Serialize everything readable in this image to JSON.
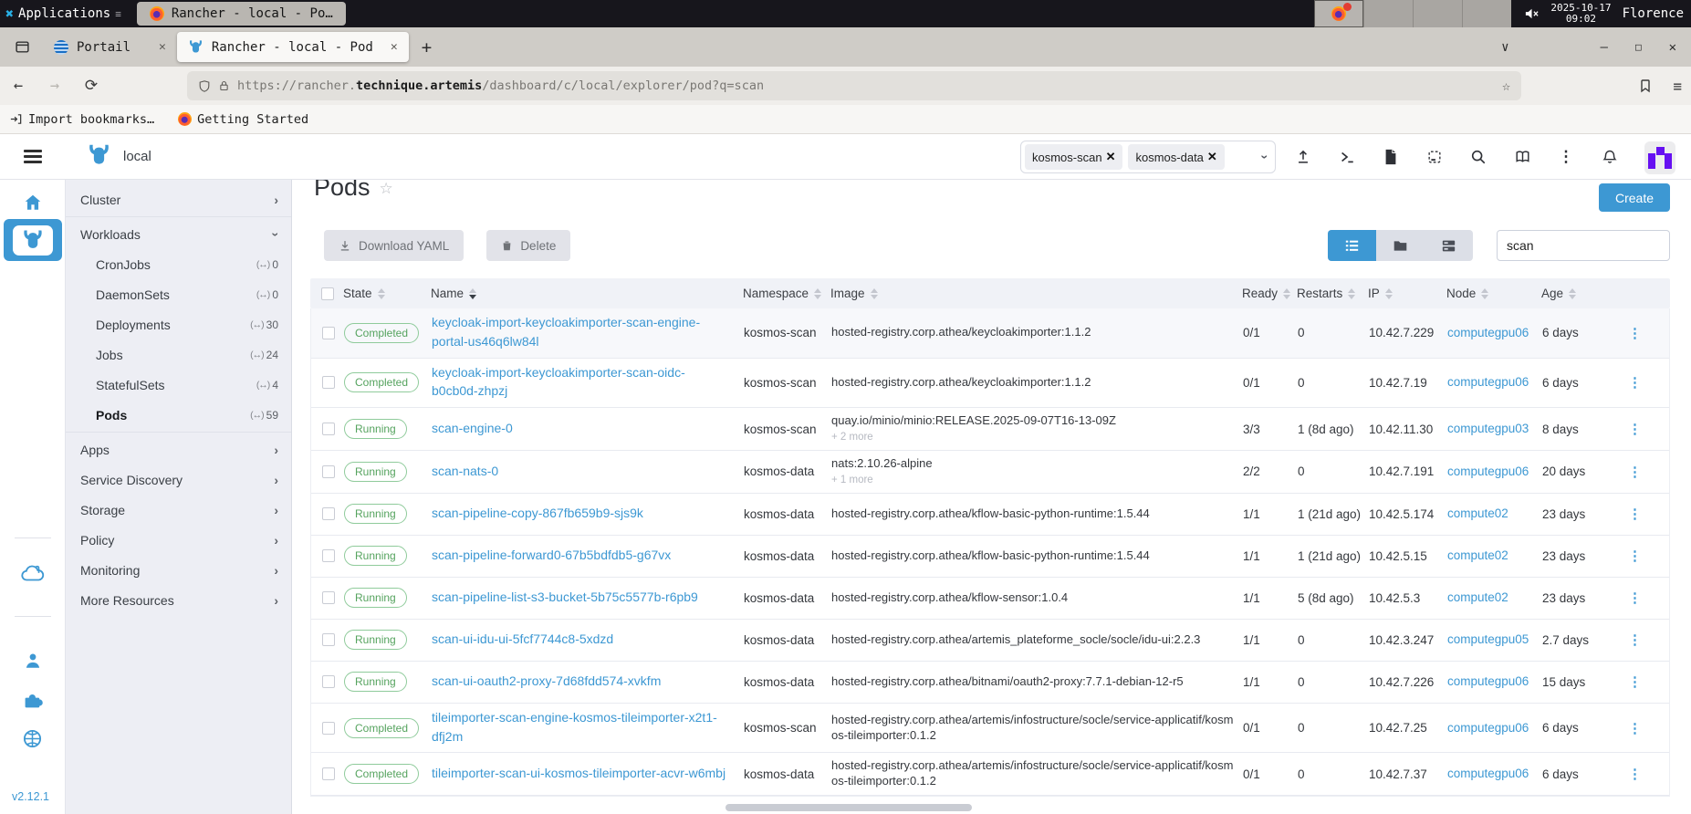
{
  "system_bar": {
    "applications_label": "Applications",
    "window_title": "Rancher - local - Po…",
    "date": "2025-10-17",
    "time": "09:02",
    "user": "Florence"
  },
  "browser": {
    "tab1_label": "Portail",
    "tab2_label": "Rancher - local - Pod",
    "close_glyph": "✕",
    "new_tab_glyph": "+",
    "back_glyph": "←",
    "forward_glyph": "→",
    "reload_glyph": "⟳",
    "url_prefix": "https://rancher.",
    "url_domain": "technique.artemis",
    "url_path": "/dashboard/c/local/explorer/pod?q=scan",
    "star_glyph": "☆",
    "bookmark1": "Import bookmarks…",
    "bookmark2": "Getting Started",
    "tab_chevron": "∨",
    "minimize_glyph": "–",
    "maximize_glyph": "□",
    "menu_glyph": "≡"
  },
  "header": {
    "cluster_name": "local",
    "namespace_chips": [
      "kosmos-scan",
      "kosmos-data"
    ],
    "icons": [
      "upload-icon",
      "terminal-icon",
      "file-icon",
      "clipboard-icon",
      "search-icon",
      "book-icon",
      "kebab-menu-icon",
      "bell-icon"
    ]
  },
  "sidebar": {
    "items": [
      {
        "label": "Cluster",
        "chevron": "right",
        "sep_after": true
      },
      {
        "label": "Workloads",
        "chevron": "down"
      },
      {
        "label": "CronJobs",
        "count": "0",
        "sub": true
      },
      {
        "label": "DaemonSets",
        "count": "0",
        "sub": true
      },
      {
        "label": "Deployments",
        "count": "30",
        "sub": true
      },
      {
        "label": "Jobs",
        "count": "24",
        "sub": true
      },
      {
        "label": "StatefulSets",
        "count": "4",
        "sub": true
      },
      {
        "label": "Pods",
        "count": "59",
        "sub": true,
        "active": true,
        "sep_after": true
      },
      {
        "label": "Apps",
        "chevron": "right"
      },
      {
        "label": "Service Discovery",
        "chevron": "right"
      },
      {
        "label": "Storage",
        "chevron": "right"
      },
      {
        "label": "Policy",
        "chevron": "right"
      },
      {
        "label": "Monitoring",
        "chevron": "right"
      },
      {
        "label": "More Resources",
        "chevron": "right"
      }
    ],
    "count_icon_glyph": "(↔)",
    "version": "v2.12.1"
  },
  "main": {
    "title": "Pods",
    "create_label": "Create",
    "download_yaml_label": "Download YAML",
    "delete_label": "Delete",
    "search_value": "scan",
    "accent_color": "#3d98d3",
    "success_color": "#55a35e",
    "table": {
      "headers": [
        {
          "label": "State"
        },
        {
          "label": "Name",
          "sorted": true
        },
        {
          "label": "Namespace"
        },
        {
          "label": "Image"
        },
        {
          "label": "Ready"
        },
        {
          "label": "Restarts"
        },
        {
          "label": "IP"
        },
        {
          "label": "Node"
        },
        {
          "label": "Age"
        }
      ],
      "rows": [
        {
          "state": "Completed",
          "name": "keycloak-import-keycloakimporter-scan-engine-portal-us46q6lw84l",
          "namespace": "kosmos-scan",
          "image": "hosted-registry.corp.athea/keycloakimporter:1.1.2",
          "ready": "0/1",
          "restarts": "0",
          "ip": "10.42.7.229",
          "node": "computegpu06",
          "age": "6 days",
          "highlighted": true
        },
        {
          "state": "Completed",
          "name": "keycloak-import-keycloakimporter-scan-oidc-b0cb0d-zhpzj",
          "namespace": "kosmos-scan",
          "image": "hosted-registry.corp.athea/keycloakimporter:1.1.2",
          "ready": "0/1",
          "restarts": "0",
          "ip": "10.42.7.19",
          "node": "computegpu06",
          "age": "6 days"
        },
        {
          "state": "Running",
          "name": "scan-engine-0",
          "namespace": "kosmos-scan",
          "image": "quay.io/minio/minio:RELEASE.2025-09-07T16-13-09Z",
          "image_more": "+ 2 more",
          "ready": "3/3",
          "restarts": "1 (8d ago)",
          "ip": "10.42.11.30",
          "node": "computegpu03",
          "age": "8 days"
        },
        {
          "state": "Running",
          "name": "scan-nats-0",
          "namespace": "kosmos-data",
          "image": "nats:2.10.26-alpine",
          "image_more": "+ 1 more",
          "ready": "2/2",
          "restarts": "0",
          "ip": "10.42.7.191",
          "node": "computegpu06",
          "age": "20 days"
        },
        {
          "state": "Running",
          "name": "scan-pipeline-copy-867fb659b9-sjs9k",
          "namespace": "kosmos-data",
          "image": "hosted-registry.corp.athea/kflow-basic-python-runtime:1.5.44",
          "ready": "1/1",
          "restarts": "1 (21d ago)",
          "ip": "10.42.5.174",
          "node": "compute02",
          "age": "23 days"
        },
        {
          "state": "Running",
          "name": "scan-pipeline-forward0-67b5bdfdb5-g67vx",
          "namespace": "kosmos-data",
          "image": "hosted-registry.corp.athea/kflow-basic-python-runtime:1.5.44",
          "ready": "1/1",
          "restarts": "1 (21d ago)",
          "ip": "10.42.5.15",
          "node": "compute02",
          "age": "23 days"
        },
        {
          "state": "Running",
          "name": "scan-pipeline-list-s3-bucket-5b75c5577b-r6pb9",
          "namespace": "kosmos-data",
          "image": "hosted-registry.corp.athea/kflow-sensor:1.0.4",
          "ready": "1/1",
          "restarts": "5 (8d ago)",
          "ip": "10.42.5.3",
          "node": "compute02",
          "age": "23 days"
        },
        {
          "state": "Running",
          "name": "scan-ui-idu-ui-5fcf7744c8-5xdzd",
          "namespace": "kosmos-data",
          "image": "hosted-registry.corp.athea/artemis_plateforme_socle/socle/idu-ui:2.2.3",
          "ready": "1/1",
          "restarts": "0",
          "ip": "10.42.3.247",
          "node": "computegpu05",
          "age": "2.7 days"
        },
        {
          "state": "Running",
          "name": "scan-ui-oauth2-proxy-7d68fdd574-xvkfm",
          "namespace": "kosmos-data",
          "image": "hosted-registry.corp.athea/bitnami/oauth2-proxy:7.7.1-debian-12-r5",
          "ready": "1/1",
          "restarts": "0",
          "ip": "10.42.7.226",
          "node": "computegpu06",
          "age": "15 days"
        },
        {
          "state": "Completed",
          "name": "tileimporter-scan-engine-kosmos-tileimporter-x2t1-dfj2m",
          "namespace": "kosmos-scan",
          "image": "hosted-registry.corp.athea/artemis/infostructure/socle/service-applicatif/kosmos-tileimporter:0.1.2",
          "ready": "0/1",
          "restarts": "0",
          "ip": "10.42.7.25",
          "node": "computegpu06",
          "age": "6 days"
        },
        {
          "state": "Completed",
          "name": "tileimporter-scan-ui-kosmos-tileimporter-acvr-w6mbj",
          "namespace": "kosmos-data",
          "image": "hosted-registry.corp.athea/artemis/infostructure/socle/service-applicatif/kosmos-tileimporter:0.1.2",
          "ready": "0/1",
          "restarts": "0",
          "ip": "10.42.7.37",
          "node": "computegpu06",
          "age": "6 days"
        }
      ]
    }
  }
}
